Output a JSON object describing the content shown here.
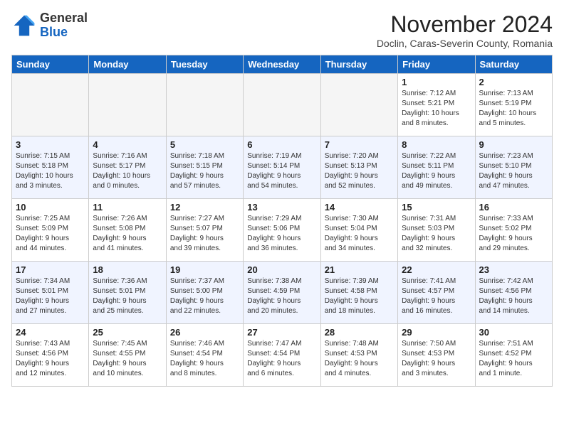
{
  "header": {
    "logo_line1": "General",
    "logo_line2": "Blue",
    "month": "November 2024",
    "location": "Doclin, Caras-Severin County, Romania"
  },
  "weekdays": [
    "Sunday",
    "Monday",
    "Tuesday",
    "Wednesday",
    "Thursday",
    "Friday",
    "Saturday"
  ],
  "weeks": [
    [
      {
        "day": "",
        "info": ""
      },
      {
        "day": "",
        "info": ""
      },
      {
        "day": "",
        "info": ""
      },
      {
        "day": "",
        "info": ""
      },
      {
        "day": "",
        "info": ""
      },
      {
        "day": "1",
        "info": "Sunrise: 7:12 AM\nSunset: 5:21 PM\nDaylight: 10 hours\nand 8 minutes."
      },
      {
        "day": "2",
        "info": "Sunrise: 7:13 AM\nSunset: 5:19 PM\nDaylight: 10 hours\nand 5 minutes."
      }
    ],
    [
      {
        "day": "3",
        "info": "Sunrise: 7:15 AM\nSunset: 5:18 PM\nDaylight: 10 hours\nand 3 minutes."
      },
      {
        "day": "4",
        "info": "Sunrise: 7:16 AM\nSunset: 5:17 PM\nDaylight: 10 hours\nand 0 minutes."
      },
      {
        "day": "5",
        "info": "Sunrise: 7:18 AM\nSunset: 5:15 PM\nDaylight: 9 hours\nand 57 minutes."
      },
      {
        "day": "6",
        "info": "Sunrise: 7:19 AM\nSunset: 5:14 PM\nDaylight: 9 hours\nand 54 minutes."
      },
      {
        "day": "7",
        "info": "Sunrise: 7:20 AM\nSunset: 5:13 PM\nDaylight: 9 hours\nand 52 minutes."
      },
      {
        "day": "8",
        "info": "Sunrise: 7:22 AM\nSunset: 5:11 PM\nDaylight: 9 hours\nand 49 minutes."
      },
      {
        "day": "9",
        "info": "Sunrise: 7:23 AM\nSunset: 5:10 PM\nDaylight: 9 hours\nand 47 minutes."
      }
    ],
    [
      {
        "day": "10",
        "info": "Sunrise: 7:25 AM\nSunset: 5:09 PM\nDaylight: 9 hours\nand 44 minutes."
      },
      {
        "day": "11",
        "info": "Sunrise: 7:26 AM\nSunset: 5:08 PM\nDaylight: 9 hours\nand 41 minutes."
      },
      {
        "day": "12",
        "info": "Sunrise: 7:27 AM\nSunset: 5:07 PM\nDaylight: 9 hours\nand 39 minutes."
      },
      {
        "day": "13",
        "info": "Sunrise: 7:29 AM\nSunset: 5:06 PM\nDaylight: 9 hours\nand 36 minutes."
      },
      {
        "day": "14",
        "info": "Sunrise: 7:30 AM\nSunset: 5:04 PM\nDaylight: 9 hours\nand 34 minutes."
      },
      {
        "day": "15",
        "info": "Sunrise: 7:31 AM\nSunset: 5:03 PM\nDaylight: 9 hours\nand 32 minutes."
      },
      {
        "day": "16",
        "info": "Sunrise: 7:33 AM\nSunset: 5:02 PM\nDaylight: 9 hours\nand 29 minutes."
      }
    ],
    [
      {
        "day": "17",
        "info": "Sunrise: 7:34 AM\nSunset: 5:01 PM\nDaylight: 9 hours\nand 27 minutes."
      },
      {
        "day": "18",
        "info": "Sunrise: 7:36 AM\nSunset: 5:01 PM\nDaylight: 9 hours\nand 25 minutes."
      },
      {
        "day": "19",
        "info": "Sunrise: 7:37 AM\nSunset: 5:00 PM\nDaylight: 9 hours\nand 22 minutes."
      },
      {
        "day": "20",
        "info": "Sunrise: 7:38 AM\nSunset: 4:59 PM\nDaylight: 9 hours\nand 20 minutes."
      },
      {
        "day": "21",
        "info": "Sunrise: 7:39 AM\nSunset: 4:58 PM\nDaylight: 9 hours\nand 18 minutes."
      },
      {
        "day": "22",
        "info": "Sunrise: 7:41 AM\nSunset: 4:57 PM\nDaylight: 9 hours\nand 16 minutes."
      },
      {
        "day": "23",
        "info": "Sunrise: 7:42 AM\nSunset: 4:56 PM\nDaylight: 9 hours\nand 14 minutes."
      }
    ],
    [
      {
        "day": "24",
        "info": "Sunrise: 7:43 AM\nSunset: 4:56 PM\nDaylight: 9 hours\nand 12 minutes."
      },
      {
        "day": "25",
        "info": "Sunrise: 7:45 AM\nSunset: 4:55 PM\nDaylight: 9 hours\nand 10 minutes."
      },
      {
        "day": "26",
        "info": "Sunrise: 7:46 AM\nSunset: 4:54 PM\nDaylight: 9 hours\nand 8 minutes."
      },
      {
        "day": "27",
        "info": "Sunrise: 7:47 AM\nSunset: 4:54 PM\nDaylight: 9 hours\nand 6 minutes."
      },
      {
        "day": "28",
        "info": "Sunrise: 7:48 AM\nSunset: 4:53 PM\nDaylight: 9 hours\nand 4 minutes."
      },
      {
        "day": "29",
        "info": "Sunrise: 7:50 AM\nSunset: 4:53 PM\nDaylight: 9 hours\nand 3 minutes."
      },
      {
        "day": "30",
        "info": "Sunrise: 7:51 AM\nSunset: 4:52 PM\nDaylight: 9 hours\nand 1 minute."
      }
    ]
  ]
}
